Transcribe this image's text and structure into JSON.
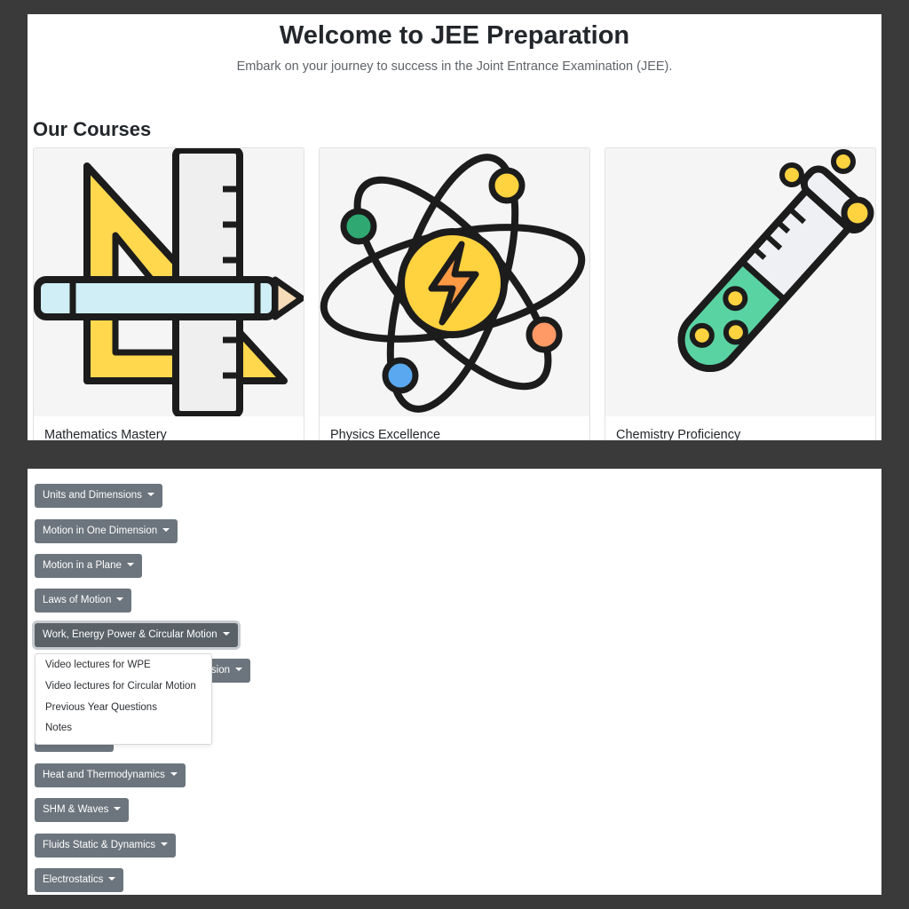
{
  "header": {
    "title": "Welcome to JEE Preparation",
    "subtitle": "Embark on your journey to success in the Joint Entrance Examination (JEE)."
  },
  "courses": {
    "heading": "Our Courses",
    "items": [
      {
        "title": "Mathematics Mastery",
        "icon": "ruler-pencil-triangle-icon"
      },
      {
        "title": "Physics Excellence",
        "icon": "atom-icon"
      },
      {
        "title": "Chemistry Proficiency",
        "icon": "test-tube-icon"
      }
    ]
  },
  "topics": [
    "Units and Dimensions",
    "Motion in One Dimension",
    "Motion in a Plane",
    "Laws of Motion",
    "Work, Energy Power & Circular Motion",
    "sion",
    "Heat and Thermodynamics",
    "SHM & Waves",
    "Fluids Static & Dynamics",
    "Electrostatics"
  ],
  "open_menu": {
    "items": [
      "Video lectures for WPE",
      "Video lectures for Circular Motion",
      "Previous Year Questions",
      "Notes"
    ]
  },
  "colors": {
    "page_background": "#3a3a3a",
    "button": "#6c757d",
    "button_active": "#5a6268",
    "ruler_yellow": "#ffd84d",
    "pencil_blue": "#cfeef5",
    "atom_center": "#ffd23f",
    "atom_bolt": "#ff9944",
    "electron_green": "#2fa872",
    "electron_blue": "#5aa9f0",
    "liquid_green": "#5ad3a3"
  }
}
